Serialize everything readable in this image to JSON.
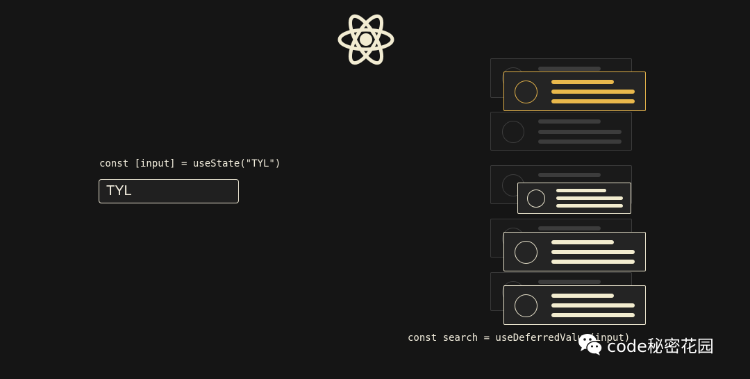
{
  "logo": {
    "icon": "react-atom-icon",
    "color": "#f2ecd2"
  },
  "state_code": "const [input] = useState(\"TYL\")",
  "input": {
    "value": "TYL"
  },
  "deferred_code": "const search = useDeferredValue(input)",
  "colors": {
    "background": "#151515",
    "highlight": "#e3b24a",
    "active": "#f2ecd2",
    "ghost": "#3c3c3c"
  },
  "watermark": {
    "icon": "wechat-icon",
    "text": "code秘密花园"
  }
}
